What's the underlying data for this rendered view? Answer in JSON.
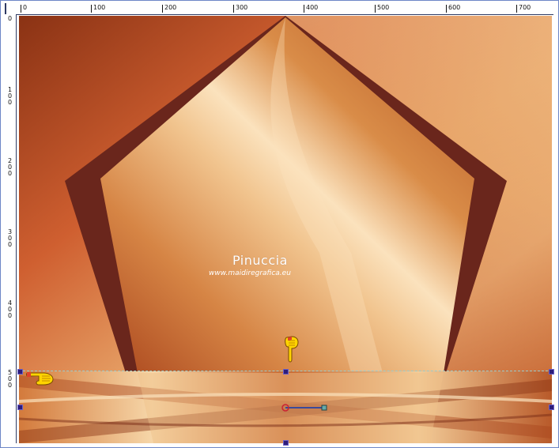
{
  "ruler": {
    "top_labels": [
      "0",
      "100",
      "200",
      "300",
      "400",
      "500",
      "600",
      "700"
    ],
    "left_labels": [
      "0",
      "100",
      "200",
      "300",
      "400",
      "500"
    ]
  },
  "canvas": {
    "watermark_title": "Pinuccia",
    "watermark_url": "www.maidiregrafica.eu",
    "colors": {
      "background_dark": "#8a3214",
      "background_mid": "#cf5f30",
      "background_light": "#f3c590",
      "pentagon_shadow": "#6a261c",
      "pentagon_light": "#fbe2bd"
    }
  },
  "tools": {
    "pointer_down_icon": "hand-pointer-down-icon",
    "pointer_right_icon": "hand-pointer-right-icon",
    "deform_handle_icon": "transform-handle-icon"
  }
}
